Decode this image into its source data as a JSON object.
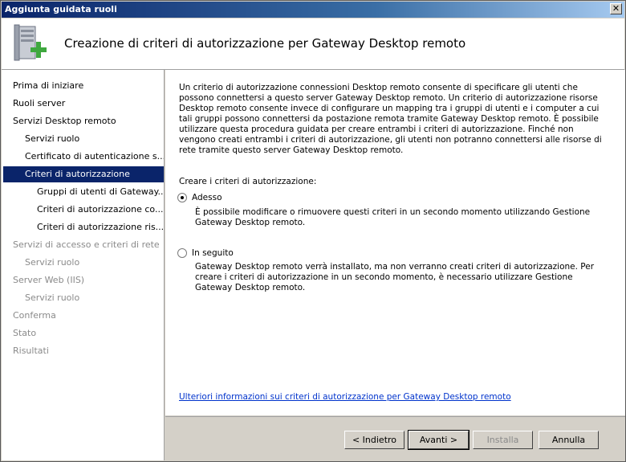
{
  "window": {
    "title": "Aggiunta guidata ruoli",
    "close_symbol": "✕"
  },
  "header": {
    "title": "Creazione di criteri di autorizzazione per Gateway Desktop remoto",
    "icon": "server-add-icon"
  },
  "sidebar": {
    "items": [
      {
        "label": "Prima di iniziare",
        "level": 0,
        "state": "normal"
      },
      {
        "label": "Ruoli server",
        "level": 0,
        "state": "normal"
      },
      {
        "label": "Servizi Desktop remoto",
        "level": 0,
        "state": "normal"
      },
      {
        "label": "Servizi ruolo",
        "level": 1,
        "state": "normal"
      },
      {
        "label": "Certificato di autenticazione s...",
        "level": 1,
        "state": "normal"
      },
      {
        "label": "Criteri di autorizzazione",
        "level": 1,
        "state": "selected"
      },
      {
        "label": "Gruppi di utenti di Gateway...",
        "level": 2,
        "state": "normal"
      },
      {
        "label": "Criteri di autorizzazione co...",
        "level": 2,
        "state": "normal"
      },
      {
        "label": "Criteri di autorizzazione ris...",
        "level": 2,
        "state": "normal"
      },
      {
        "label": "Servizi di accesso e criteri di rete",
        "level": 0,
        "state": "disabled"
      },
      {
        "label": "Servizi ruolo",
        "level": 1,
        "state": "disabled"
      },
      {
        "label": "Server Web (IIS)",
        "level": 0,
        "state": "disabled"
      },
      {
        "label": "Servizi ruolo",
        "level": 1,
        "state": "disabled"
      },
      {
        "label": "Conferma",
        "level": 0,
        "state": "disabled"
      },
      {
        "label": "Stato",
        "level": 0,
        "state": "disabled"
      },
      {
        "label": "Risultati",
        "level": 0,
        "state": "disabled"
      }
    ]
  },
  "content": {
    "intro": "Un criterio di autorizzazione connessioni Desktop remoto consente di specificare gli utenti che possono connettersi a questo server Gateway Desktop remoto. Un criterio di autorizzazione risorse Desktop remoto consente invece di configurare un mapping tra i gruppi di utenti e i computer a cui tali gruppi possono connettersi da postazione remota tramite Gateway Desktop remoto. È possibile utilizzare questa procedura guidata per creare entrambi i criteri di autorizzazione. Finché non vengono creati entrambi i criteri di autorizzazione, gli utenti non potranno connettersi alle risorse di rete tramite questo server Gateway Desktop remoto.",
    "create_label": "Creare i criteri di autorizzazione:",
    "option_now": {
      "label": "Adesso",
      "checked": true,
      "desc": "È possibile modificare o rimuovere questi criteri in un secondo momento utilizzando Gestione Gateway Desktop remoto."
    },
    "option_later": {
      "label": "In seguito",
      "checked": false,
      "desc": "Gateway Desktop remoto verrà installato, ma non verranno creati criteri di autorizzazione. Per creare i criteri di autorizzazione in un secondo momento, è necessario utilizzare Gestione Gateway Desktop remoto."
    },
    "more_info_link": "Ulteriori informazioni sui criteri di autorizzazione per Gateway Desktop remoto"
  },
  "footer": {
    "back": "< Indietro",
    "next": "Avanti >",
    "install": "Installa",
    "cancel": "Annulla"
  }
}
